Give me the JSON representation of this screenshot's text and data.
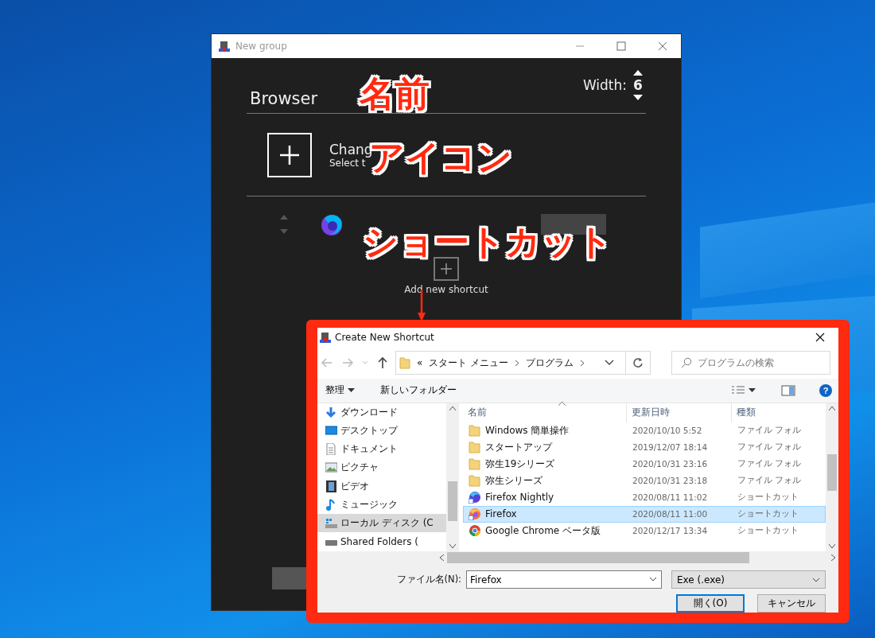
{
  "group_window": {
    "title": "New group",
    "name": "Browser",
    "width_label": "Width:",
    "width_value": "6",
    "change_icon": {
      "title": "Chang",
      "subtitle": "Select t"
    },
    "add_label": "Add new shortcut"
  },
  "dialog": {
    "title": "Create New Shortcut",
    "overflow": "«",
    "breadcrumb": [
      "スタート メニュー",
      "プログラム"
    ],
    "search": {
      "placeholder": "プログラムの検索"
    },
    "toolbar": {
      "organize": "整理",
      "new_folder": "新しいフォルダー",
      "help": "?"
    },
    "tree": [
      {
        "label": "ダウンロード",
        "kind": "download",
        "selected": false
      },
      {
        "label": "デスクトップ",
        "kind": "desktop",
        "selected": false
      },
      {
        "label": "ドキュメント",
        "kind": "document",
        "selected": false
      },
      {
        "label": "ピクチャ",
        "kind": "picture",
        "selected": false
      },
      {
        "label": "ビデオ",
        "kind": "video",
        "selected": false
      },
      {
        "label": "ミュージック",
        "kind": "music",
        "selected": false
      },
      {
        "label": "ローカル ディスク (C",
        "kind": "disk",
        "selected": true
      },
      {
        "label": "Shared Folders (",
        "kind": "drive",
        "selected": false
      }
    ],
    "columns": [
      "名前",
      "更新日時",
      "種類"
    ],
    "files": [
      {
        "name": "Windows 簡単操作",
        "date": "2020/10/10 5:52",
        "type": "ファイル フォル",
        "kind": "folder",
        "selected": false
      },
      {
        "name": "スタートアップ",
        "date": "2019/12/07 18:14",
        "type": "ファイル フォル",
        "kind": "folder",
        "selected": false
      },
      {
        "name": "弥生19シリーズ",
        "date": "2020/10/31 23:16",
        "type": "ファイル フォル",
        "kind": "folder",
        "selected": false
      },
      {
        "name": "弥生シリーズ",
        "date": "2020/10/31 23:18",
        "type": "ファイル フォル",
        "kind": "folder",
        "selected": false
      },
      {
        "name": "Firefox Nightly",
        "date": "2020/08/11 11:02",
        "type": "ショートカット",
        "kind": "nightly",
        "selected": false
      },
      {
        "name": "Firefox",
        "date": "2020/08/11 11:00",
        "type": "ショートカット",
        "kind": "firefox",
        "selected": true
      },
      {
        "name": "Google Chrome ベータ版",
        "date": "2020/12/17 13:34",
        "type": "ショートカット",
        "kind": "chrome",
        "selected": false
      }
    ],
    "filename": {
      "label": "ファイル名(N):",
      "value": "Firefox"
    },
    "filetype": "Exe (.exe)",
    "buttons": [
      {
        "label": "開く(O)",
        "default": true
      },
      {
        "label": "キャンセル",
        "default": false
      }
    ]
  },
  "annotations": [
    {
      "text": "名前"
    },
    {
      "text": "アイコン"
    },
    {
      "text": "ショートカット"
    }
  ]
}
